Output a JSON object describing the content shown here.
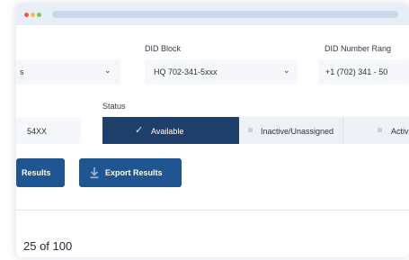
{
  "filters": {
    "first_select_value": "s",
    "did_block_label": "DID Block",
    "did_block_value": "HQ 702-341-5xxx",
    "did_range_label": "DID Number Rang",
    "did_range_value": "+1 (702) 341 - 50",
    "extension_value": "54XX"
  },
  "status": {
    "label": "Status",
    "options": [
      {
        "label": "Available",
        "selected": true
      },
      {
        "label": "Inactive/Unassigned",
        "selected": false
      },
      {
        "label": "Activ",
        "selected": false
      }
    ]
  },
  "actions": {
    "results_label": "Results",
    "export_label": "Export Results"
  },
  "pagination": {
    "text": "25 of 100"
  },
  "colors": {
    "primary": "#1f5590",
    "selected_segment": "#1f3f6b",
    "titlebar": "#e8eef6"
  }
}
